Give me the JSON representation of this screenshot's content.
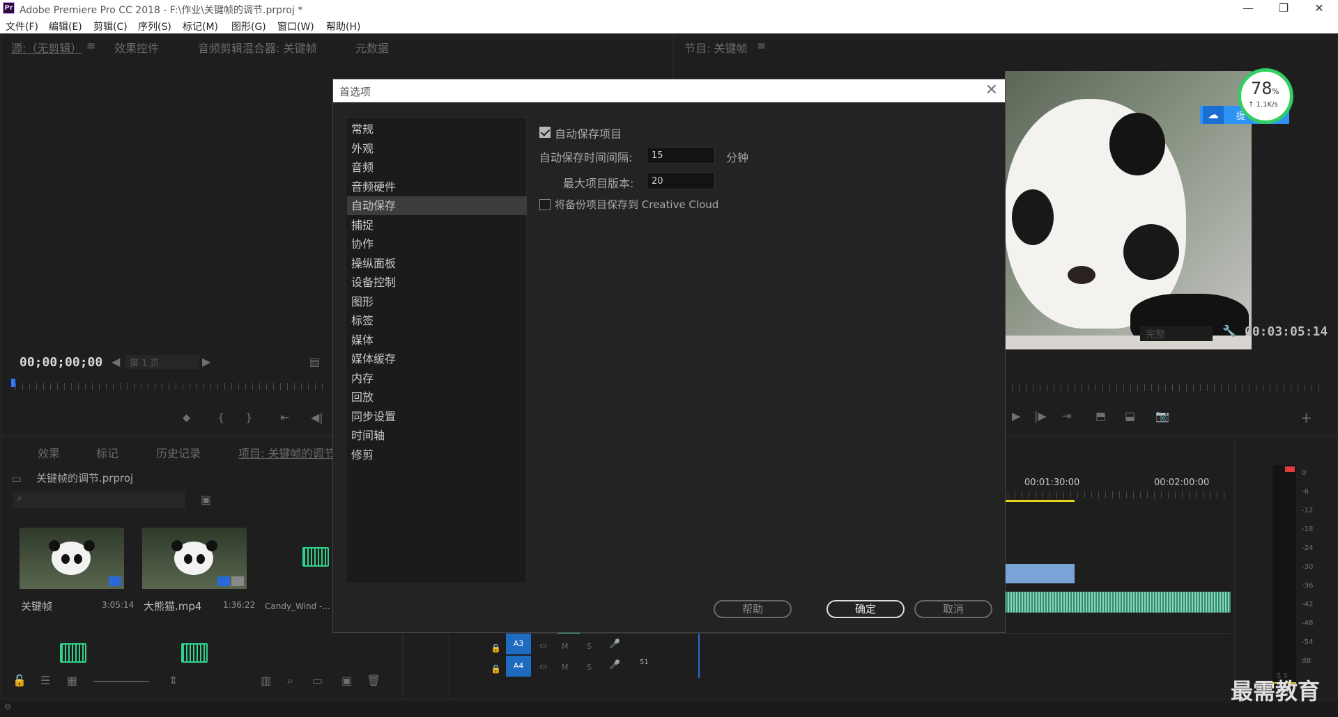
{
  "titlebar": {
    "logo": "Pr",
    "title": "Adobe Premiere Pro CC 2018 - F:\\作业\\关键帧的调节.prproj *",
    "minimize": "—",
    "maximize": "❐",
    "close": "✕"
  },
  "menu": [
    "文件(F)",
    "编辑(E)",
    "剪辑(C)",
    "序列(S)",
    "标记(M)",
    "图形(G)",
    "窗口(W)",
    "帮助(H)"
  ],
  "source_panel": {
    "tabs": [
      "源:（无剪辑）",
      "效果控件",
      "音频剪辑混合器: 关键帧",
      "元数据"
    ],
    "timecode": "00;00;00;00",
    "page_select": "第 1 页"
  },
  "program_panel": {
    "tab": "节目: 关键帧",
    "fit_select": "完整",
    "timecode": "00:03:05:14"
  },
  "overlay": {
    "percent": "78",
    "percent_unit": "%",
    "speed": "↑ 1.1K/s",
    "cloud_text": "提"
  },
  "project_panel": {
    "tabs": [
      "效果",
      "标记",
      "历史记录",
      "项目: 关键帧的调节"
    ],
    "project_name": "关键帧的调节.prproj",
    "items": [
      {
        "name": "关键帧",
        "duration": "3:05:14"
      },
      {
        "name": "大熊猫.mp4",
        "duration": "1:36:22"
      },
      {
        "name": "Candy_Wind -...",
        "duration": ""
      }
    ]
  },
  "timeline": {
    "time1": "00:01:30:00",
    "time2": "00:02:00:00",
    "tracks": [
      {
        "name": "A3",
        "m": "M",
        "s": "S"
      },
      {
        "name": "A4",
        "m": "M",
        "s": "S"
      }
    ],
    "extra": "51"
  },
  "meter": {
    "scale": [
      "0",
      "-6",
      "-12",
      "-18",
      "-24",
      "-30",
      "-36",
      "-42",
      "-48",
      "-54",
      "dB"
    ],
    "footer": "S S"
  },
  "watermark": "最需教育",
  "dialog": {
    "title": "首选项",
    "close": "✕",
    "categories": [
      "常规",
      "外观",
      "音频",
      "音频硬件",
      "自动保存",
      "捕捉",
      "协作",
      "操纵面板",
      "设备控制",
      "图形",
      "标签",
      "媒体",
      "媒体缓存",
      "内存",
      "回放",
      "同步设置",
      "时间轴",
      "修剪"
    ],
    "selected_category": "自动保存",
    "autosave": {
      "enable_label": "自动保存项目",
      "enable_checked": true,
      "interval_label": "自动保存时间间隔:",
      "interval_value": "15",
      "interval_unit": "分钟",
      "max_versions_label": "最大项目版本:",
      "max_versions_value": "20",
      "cloud_backup_label": "将备份项目保存到 Creative Cloud",
      "cloud_backup_checked": false
    },
    "buttons": {
      "help": "帮助",
      "ok": "确定",
      "cancel": "取消"
    }
  }
}
